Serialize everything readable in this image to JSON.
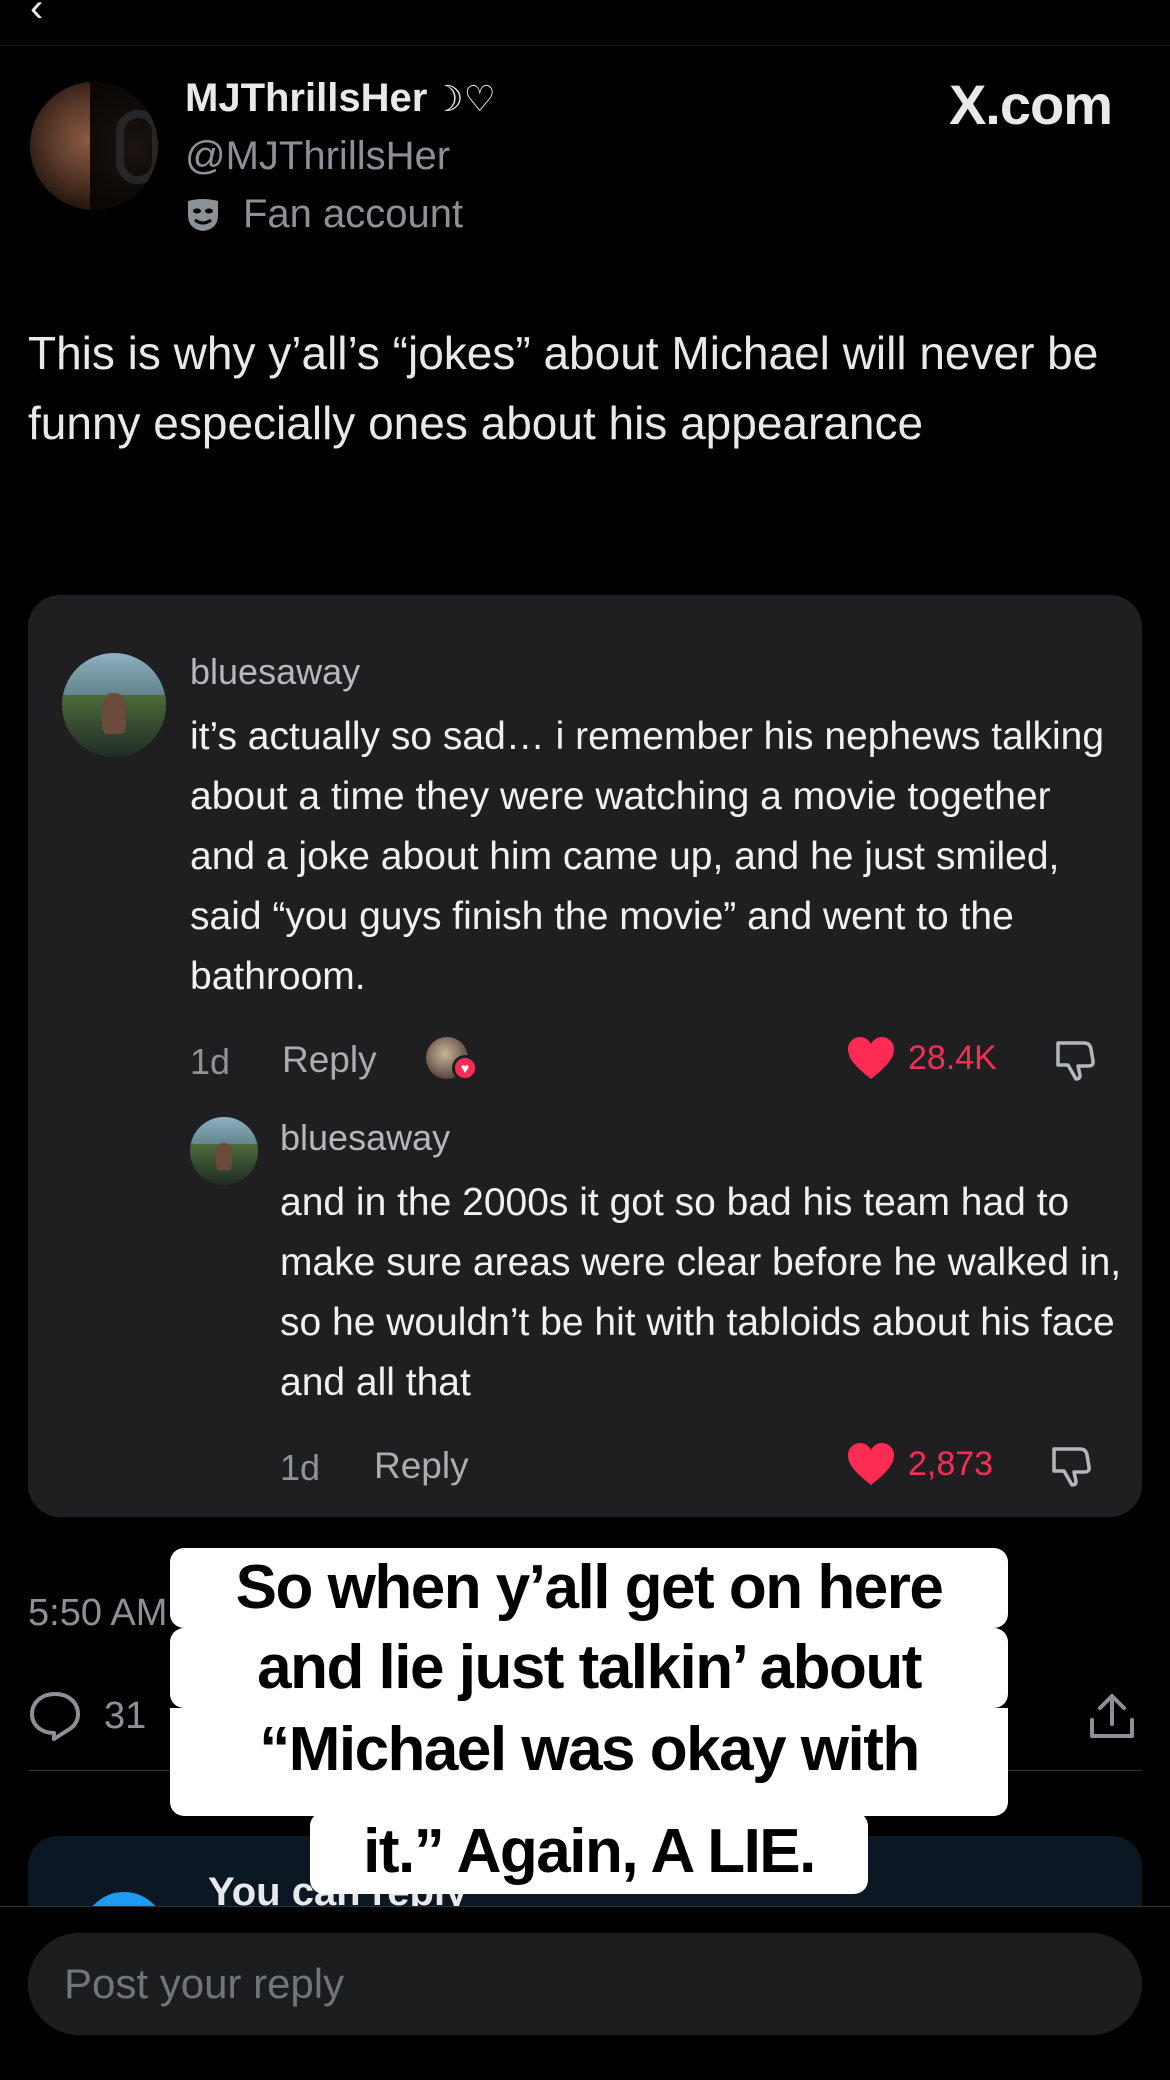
{
  "post": {
    "display_name": "MJThrillsHer",
    "name_symbols": "☽♡",
    "handle": "@MJThrillsHer",
    "label": "Fan account",
    "label_icon": "theater-mask-icon",
    "watermark": "X.com",
    "text": "This is why y’all’s “jokes” about Michael will never be funny especially ones about his appearance",
    "time": "5:50 AM",
    "reply_count": "31"
  },
  "embedded_comments": [
    {
      "user": "bluesaway",
      "text": "it’s actually so sad… i remember his nephews talking about a time they were watching a movie together and a joke about him came up, and he just smiled, said “you guys finish the movie” and went to the bathroom.",
      "age": "1d",
      "reply_label": "Reply",
      "likes": "28.4K"
    },
    {
      "user": "bluesaway",
      "text": "and in the 2000s it got so bad his team had to make sure areas were clear before he walked in, so he wouldn’t be hit with tabloids about his face and all that",
      "age": "1d",
      "reply_label": "Reply",
      "likes": "2,873"
    }
  ],
  "caption_overlay": {
    "lines": [
      "So when y’all get on here",
      "and lie just talkin’ about",
      "“Michael was okay with",
      "it.” Again, A LIE."
    ]
  },
  "reply_banner": {
    "text": "You can reply"
  },
  "reply_box": {
    "placeholder": "Post your reply"
  },
  "colors": {
    "background": "#000000",
    "card": "#1f1f21",
    "like": "#fe2c55",
    "muted": "#8b9196"
  }
}
